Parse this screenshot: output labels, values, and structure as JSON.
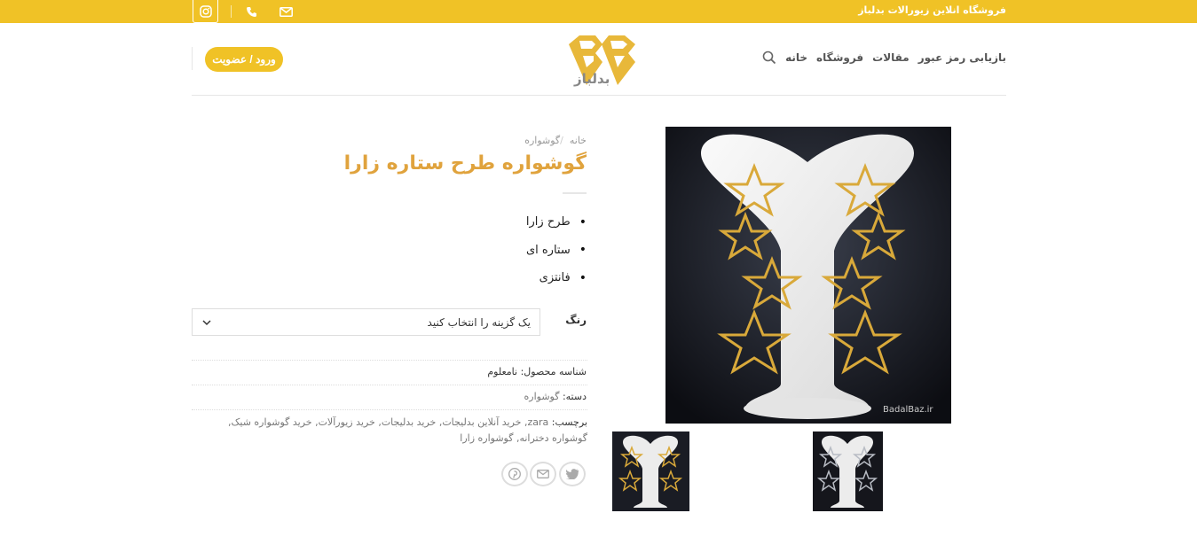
{
  "topbar": {
    "title": "فروشگاه انلاین زیورالات بدلباز",
    "icons": [
      "instagram-icon",
      "phone-icon",
      "email-icon"
    ],
    "color": "#f0c226"
  },
  "header": {
    "login_label": "ورود / عضویت",
    "logo_alt": "بدلباز",
    "nav": [
      "خانه",
      "فروشگاه",
      "مقالات",
      "بازیابی رمز عبور"
    ]
  },
  "breadcrumb": {
    "home": "خانه",
    "category": "گوشواره",
    "separator": "/"
  },
  "product": {
    "title": "گوشواره طرح ستاره زارا",
    "features": [
      "طرح زارا",
      "ستاره ای",
      "فانتزی"
    ],
    "variation_label": "رنگ",
    "variation_placeholder": "یک گزینه را انتخاب کنید",
    "sku_label": "شناسه محصول:",
    "sku_value": "نامعلوم",
    "category_label": "دسته:",
    "category_value": "گوشواره",
    "tags_label": "برچسب:",
    "tags_value": "zara, خرید آنلاین بدلیجات, خرید بدلیجات, خرید زیورآلات, خرید گوشواره شیک, گوشواره دخترانه, گوشواره زارا",
    "image_watermark": "BadalBaz.ir"
  },
  "share": {
    "icons": [
      "twitter-icon",
      "email-icon",
      "pinterest-icon"
    ]
  },
  "colors": {
    "accent": "#f0c226",
    "title": "#e0a33d"
  }
}
